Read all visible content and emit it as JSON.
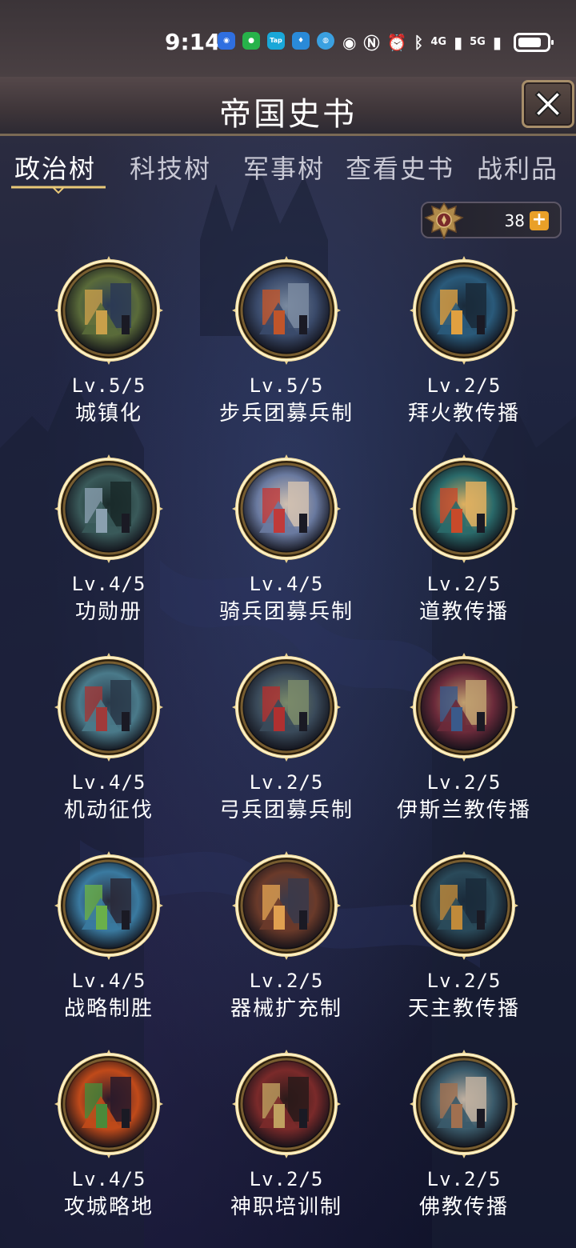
{
  "status_bar": {
    "time": "9:14",
    "network_1": "4G",
    "network_2": "5G",
    "apps": [
      "blue-app-icon",
      "wechat-icon",
      "tap-icon",
      "bulb-icon",
      "browser-icon"
    ],
    "app_tap_label": "Tap"
  },
  "header": {
    "title": "帝国史书",
    "close_icon": "close-icon"
  },
  "tabs": [
    {
      "label": "政治树",
      "active": true
    },
    {
      "label": "科技树",
      "active": false
    },
    {
      "label": "军事树",
      "active": false
    },
    {
      "label": "查看史书",
      "active": false
    },
    {
      "label": "战利品",
      "active": false
    }
  ],
  "currency": {
    "value": "38",
    "icon": "eagle-emblem-icon",
    "add_symbol": "+"
  },
  "skills": [
    {
      "level": "Lv.5/5",
      "name": "城镇化",
      "palette": [
        "#5a6b3a",
        "#c9a04a",
        "#2b3a55"
      ]
    },
    {
      "level": "Lv.5/5",
      "name": "步兵团募兵制",
      "palette": [
        "#3a4a6a",
        "#c0552a",
        "#7a8aa0"
      ]
    },
    {
      "level": "Lv.2/5",
      "name": "拜火教传播",
      "palette": [
        "#2a5a7a",
        "#e0a040",
        "#1a2a3a"
      ]
    },
    {
      "level": "Lv.4/5",
      "name": "功勋册",
      "palette": [
        "#3a5a5a",
        "#8aa0b0",
        "#1a2a2a"
      ]
    },
    {
      "level": "Lv.4/5",
      "name": "骑兵团募兵制",
      "palette": [
        "#6a7aa0",
        "#c03a3a",
        "#d0c0b0"
      ]
    },
    {
      "level": "Lv.2/5",
      "name": "道教传播",
      "palette": [
        "#2a6a6a",
        "#c84a2a",
        "#e0b060"
      ]
    },
    {
      "level": "Lv.4/5",
      "name": "机动征伐",
      "palette": [
        "#4a7a8a",
        "#a03a3a",
        "#2a3a4a"
      ]
    },
    {
      "level": "Lv.2/5",
      "name": "弓兵团募兵制",
      "palette": [
        "#3a4a5a",
        "#b03030",
        "#7a8a6a"
      ]
    },
    {
      "level": "Lv.2/5",
      "name": "伊斯兰教传播",
      "palette": [
        "#6a2a3a",
        "#3a5a8a",
        "#c0a070"
      ]
    },
    {
      "level": "Lv.4/5",
      "name": "战略制胜",
      "palette": [
        "#3a7aa0",
        "#6ab04a",
        "#2a2a3a"
      ]
    },
    {
      "level": "Lv.2/5",
      "name": "器械扩充制",
      "palette": [
        "#6a3a2a",
        "#e0a050",
        "#3a3a4a"
      ]
    },
    {
      "level": "Lv.2/5",
      "name": "天主教传播",
      "palette": [
        "#2a4a5a",
        "#c08a3a",
        "#1a2a3a"
      ]
    },
    {
      "level": "Lv.4/5",
      "name": "攻城略地",
      "palette": [
        "#c04a1a",
        "#4a8a3a",
        "#2a1a2a"
      ]
    },
    {
      "level": "Lv.2/5",
      "name": "神职培训制",
      "palette": [
        "#7a2a2a",
        "#c0a060",
        "#2a1a1a"
      ]
    },
    {
      "level": "Lv.2/5",
      "name": "佛教传播",
      "palette": [
        "#3a5a6a",
        "#a07050",
        "#c0b0a0"
      ]
    }
  ]
}
